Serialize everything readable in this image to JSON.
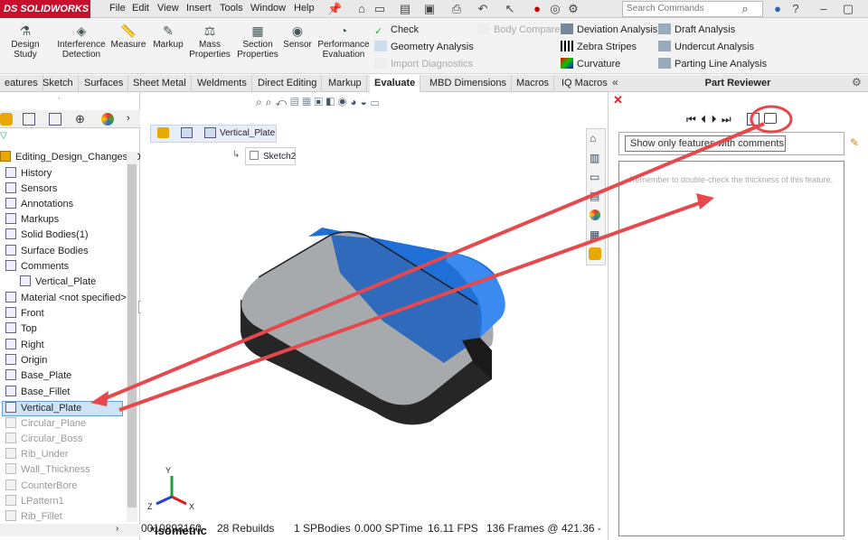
{
  "app": {
    "logo_text": "DS SOLIDWORKS"
  },
  "menu": [
    "File",
    "Edit",
    "View",
    "Insert",
    "Tools",
    "Window",
    "Help"
  ],
  "search": {
    "placeholder": "Search Commands"
  },
  "commands": {
    "big": [
      {
        "label": "Design Study",
        "icon": "design-study-icon"
      },
      {
        "label": "Interference Detection",
        "icon": "interference-icon"
      },
      {
        "label": "Measure",
        "icon": "measure-icon"
      },
      {
        "label": "Markup",
        "icon": "markup-icon"
      },
      {
        "label": "Mass Properties",
        "icon": "mass-properties-icon"
      },
      {
        "label": "Section Properties",
        "icon": "section-properties-icon"
      },
      {
        "label": "Sensor",
        "icon": "sensor-icon"
      },
      {
        "label": "Performance Evaluation",
        "icon": "performance-icon"
      }
    ],
    "col1": [
      {
        "label": "Check",
        "disabled": false
      },
      {
        "label": "Geometry Analysis",
        "disabled": false
      },
      {
        "label": "Import Diagnostics",
        "disabled": true
      }
    ],
    "body_compare": "Body Compare",
    "col2": [
      "Deviation Analysis",
      "Zebra Stripes",
      "Curvature"
    ],
    "col3": [
      "Draft Analysis",
      "Undercut Analysis",
      "Parting Line Analysis"
    ]
  },
  "tabs": [
    {
      "label": "eatures",
      "active": false
    },
    {
      "label": "Sketch",
      "active": false
    },
    {
      "label": "Surfaces",
      "active": false
    },
    {
      "label": "Sheet Metal",
      "active": false
    },
    {
      "label": "Weldments",
      "active": false
    },
    {
      "label": "Direct Editing",
      "active": false
    },
    {
      "label": "Markup",
      "active": false
    },
    {
      "label": "Evaluate",
      "active": true
    },
    {
      "label": "MBD Dimensions",
      "active": false
    },
    {
      "label": "Macros",
      "active": false
    },
    {
      "label": "IQ Macros",
      "active": false
    }
  ],
  "part_reviewer": {
    "title": "Part Reviewer",
    "tooltip": "Show only features with comments",
    "comment": "Remember to double-check the thickness of this feature."
  },
  "feature_tree": {
    "root": "Editing_Design_Changes (D",
    "items": [
      {
        "label": "History",
        "suppressed": false
      },
      {
        "label": "Sensors",
        "suppressed": false
      },
      {
        "label": "Annotations",
        "suppressed": false
      },
      {
        "label": "Markups",
        "suppressed": false
      },
      {
        "label": "Solid Bodies(1)",
        "suppressed": false
      },
      {
        "label": "Surface Bodies",
        "suppressed": false
      },
      {
        "label": "Comments",
        "suppressed": false
      },
      {
        "label": "Vertical_Plate",
        "suppressed": false,
        "indent": true
      },
      {
        "label": "Material <not specified>",
        "suppressed": false
      },
      {
        "label": "Front",
        "suppressed": false
      },
      {
        "label": "Top",
        "suppressed": false
      },
      {
        "label": "Right",
        "suppressed": false
      },
      {
        "label": "Origin",
        "suppressed": false
      },
      {
        "label": "Base_Plate",
        "suppressed": false
      },
      {
        "label": "Base_Fillet",
        "suppressed": false
      },
      {
        "label": "Vertical_Plate",
        "suppressed": false,
        "selected": true
      },
      {
        "label": "Circular_Plane",
        "suppressed": true
      },
      {
        "label": "Circular_Boss",
        "suppressed": true
      },
      {
        "label": "Rib_Under",
        "suppressed": true
      },
      {
        "label": "Wall_Thickness",
        "suppressed": true
      },
      {
        "label": "CounterBore",
        "suppressed": true
      },
      {
        "label": "LPattern1",
        "suppressed": true
      },
      {
        "label": "Rib_Fillet",
        "suppressed": true
      }
    ]
  },
  "viewport": {
    "breadcrumb": "Vertical_Plate",
    "sketch": "Sketch2",
    "view_label": "*Isometric",
    "status": [
      "0010893160",
      "28 Rebuilds",
      "1 SPBodies",
      "0.000 SPTime",
      "16.11 FPS",
      "136 Frames @ 421.36 -"
    ]
  },
  "colors": {
    "highlight": "#1f6fd6",
    "body": "#a7aaad",
    "annotation": "#e5484d",
    "logo": "#c8102e"
  }
}
